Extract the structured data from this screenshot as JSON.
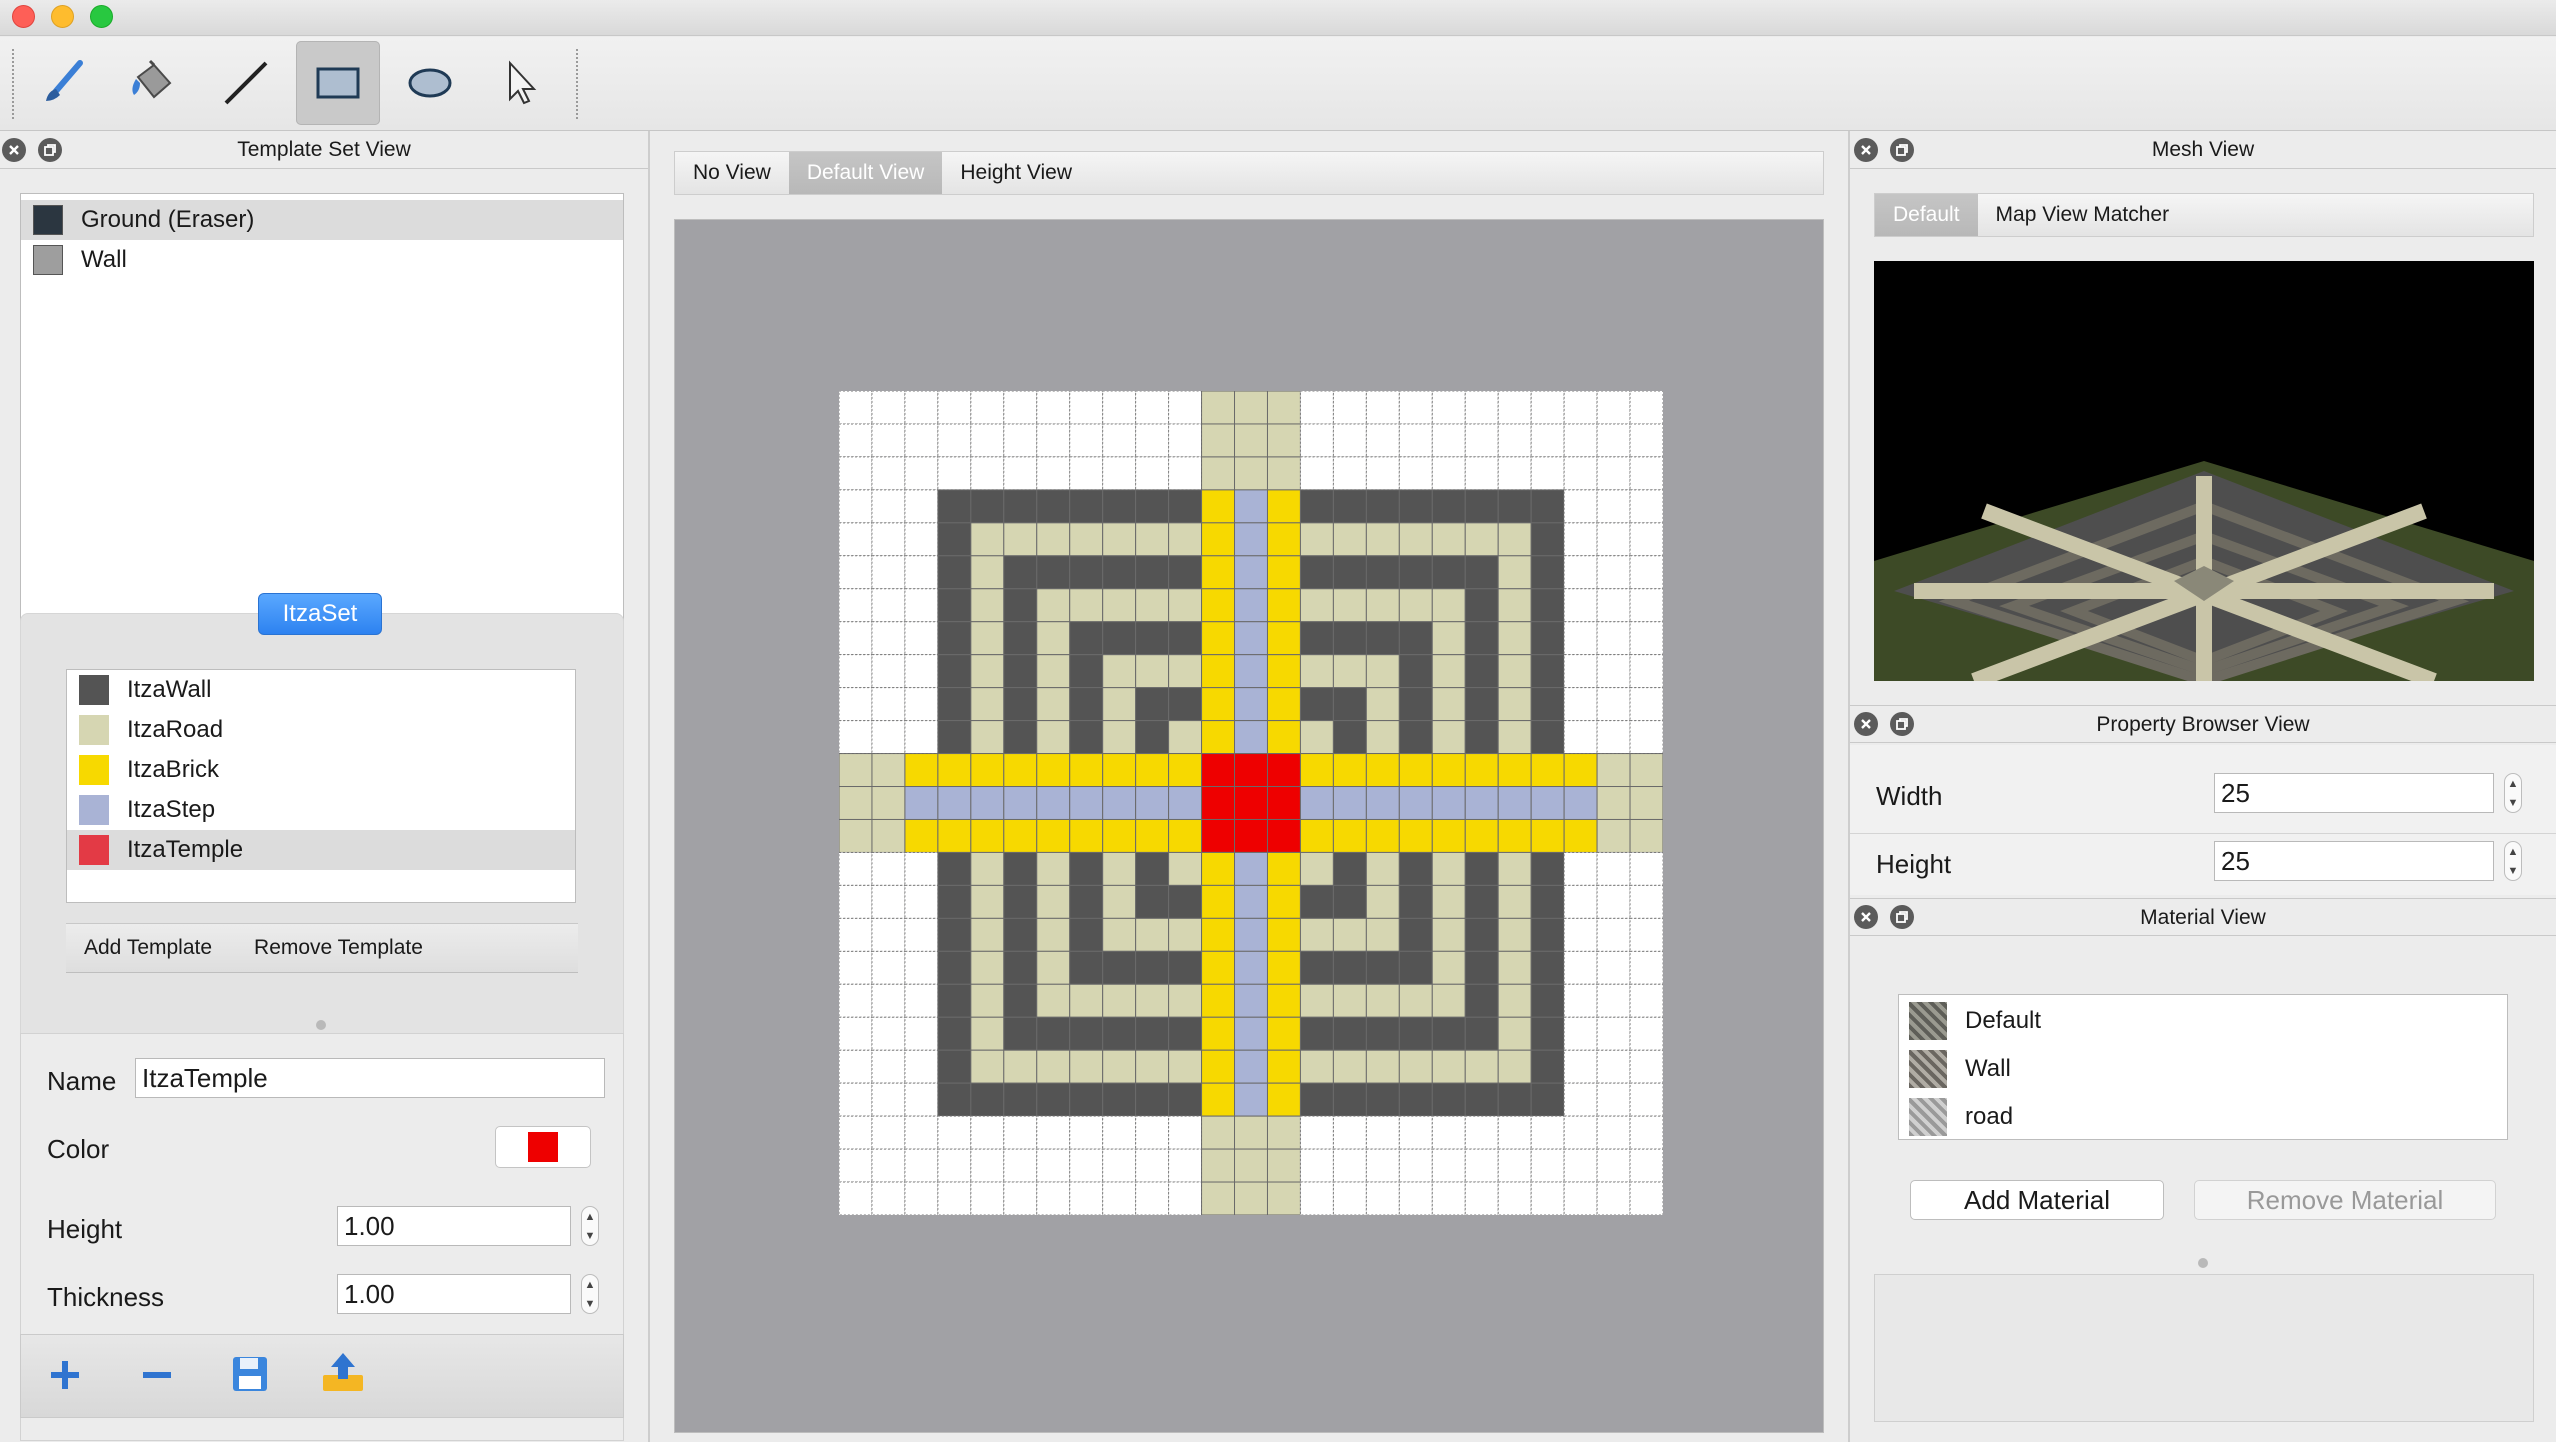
{
  "toolbar": {
    "tools": [
      {
        "name": "paintbrush-icon",
        "active": false
      },
      {
        "name": "paint-bucket-icon",
        "active": false
      },
      {
        "name": "line-icon",
        "active": false
      },
      {
        "name": "rectangle-icon",
        "active": true
      },
      {
        "name": "ellipse-icon",
        "active": false
      },
      {
        "name": "pointer-icon",
        "active": false
      }
    ]
  },
  "template_set_view": {
    "title": "Template Set View",
    "base_templates": [
      {
        "label": "Ground (Eraser)",
        "color": "#2b3640",
        "selected": true
      },
      {
        "label": "Wall",
        "color": "#9e9e9e",
        "selected": false
      }
    ],
    "set_name": "ItzaSet",
    "set_templates": [
      {
        "label": "ItzaWall",
        "color": "#545454",
        "selected": false
      },
      {
        "label": "ItzaRoad",
        "color": "#d6d6b2",
        "selected": false
      },
      {
        "label": "ItzaBrick",
        "color": "#f7d900",
        "selected": false
      },
      {
        "label": "ItzaStep",
        "color": "#a9b3d5",
        "selected": false
      },
      {
        "label": "ItzaTemple",
        "color": "#e33a45",
        "selected": true
      }
    ],
    "add_template": "Add Template",
    "remove_template": "Remove Template",
    "properties": {
      "name_label": "Name",
      "name_value": "ItzaTemple",
      "color_label": "Color",
      "color_value": "#ee0000",
      "height_label": "Height",
      "height_value": "1.00",
      "thickness_label": "Thickness",
      "thickness_value": "1.00"
    },
    "bottom_icons": [
      "add-icon",
      "remove-icon",
      "save-icon",
      "export-icon"
    ]
  },
  "map_editor": {
    "tabs": [
      {
        "label": "No View",
        "active": false
      },
      {
        "label": "Default View",
        "active": true
      },
      {
        "label": "Height View",
        "active": false
      }
    ],
    "grid_size": 25,
    "palette": {
      "0": "#ffffff",
      "W": "#545454",
      "R": "#d6d6b2",
      "B": "#f7d900",
      "S": "#a9b3d5",
      "T": "#ee0000"
    },
    "rows": [
      "00000000000RRR00000000000",
      "00000000000RRR00000000000",
      "00000000000RRR00000000000",
      "000WWWWWWWWBSBWWWWWWWW000",
      "000WRRRRRRRBSBRRRRRRRW000",
      "000WRWWWWWWBSBWWWWWWRW000",
      "000WRWRRRRRBSBRRRRRWRW000",
      "000WRWRWWWWBSBWWWWRWRW000",
      "000WRWRWRRRBSBRRRWRWRW000",
      "000WRWRWRWWBSBWWRWRWRW000",
      "000WRWRWRWRBSBRWRWRWRW000",
      "RRBBBBBBBBBTTTBBBBBBBBBRR",
      "RRSSSSSSSSSTTTSSSSSSSSSRR",
      "RRBBBBBBBBBTTTBBBBBBBBBRR",
      "000WRWRWRWRBSBRWRWRWRW000",
      "000WRWRWRWWBSBWWRWRWRW000",
      "000WRWRWRRRBSBRRRWRWRW000",
      "000WRWRWWWWBSBWWWWRWRW000",
      "000WRWRRRRRBSBRRRRRWRW000",
      "000WRWWWWWWBSBWWWWWWRW000",
      "000WRRRRRRRBSBRRRRRRRW000",
      "000WWWWWWWWBSBWWWWWWWW000",
      "00000000000RRR00000000000",
      "00000000000RRR00000000000",
      "00000000000RRR00000000000"
    ]
  },
  "mesh_view": {
    "title": "Mesh View",
    "tabs": [
      {
        "label": "Default",
        "active": true
      },
      {
        "label": "Map View Matcher",
        "active": false
      }
    ]
  },
  "property_browser": {
    "title": "Property Browser View",
    "width_label": "Width",
    "width_value": "25",
    "height_label": "Height",
    "height_value": "25"
  },
  "material_view": {
    "title": "Material View",
    "materials": [
      {
        "label": "Default"
      },
      {
        "label": "Wall"
      },
      {
        "label": "road"
      }
    ],
    "add_material": "Add Material",
    "remove_material": "Remove Material"
  }
}
